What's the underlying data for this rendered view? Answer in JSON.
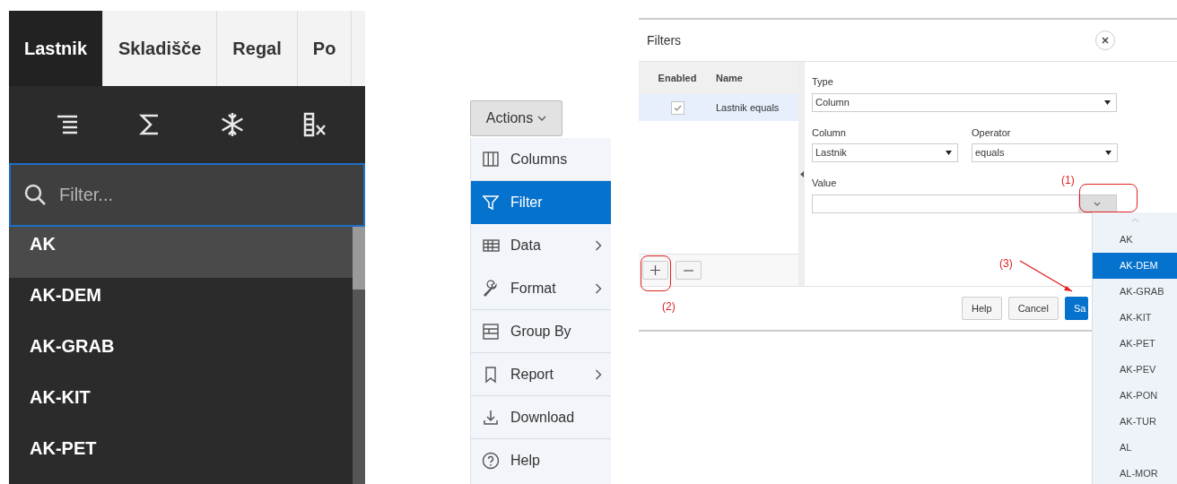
{
  "column_menu": {
    "tabs": [
      {
        "label": "Lastnik",
        "selected": true
      },
      {
        "label": "Skladišče",
        "selected": false
      },
      {
        "label": "Regal",
        "selected": false
      },
      {
        "label": "Po",
        "selected": false
      }
    ],
    "filter": {
      "placeholder": "Filter..."
    },
    "values": [
      {
        "label": "AK",
        "selected": true
      },
      {
        "label": "AK-DEM",
        "selected": false
      },
      {
        "label": "AK-GRAB",
        "selected": false
      },
      {
        "label": "AK-KIT",
        "selected": false
      },
      {
        "label": "AK-PET",
        "selected": false
      }
    ]
  },
  "actions_menu": {
    "button": "Actions",
    "items": [
      {
        "kind": "columns",
        "label": "Columns",
        "selected": false,
        "submenu": false,
        "divider_after": true
      },
      {
        "kind": "filter",
        "label": "Filter",
        "selected": true,
        "submenu": false,
        "divider_after": false
      },
      {
        "kind": "data",
        "label": "Data",
        "selected": false,
        "submenu": true,
        "divider_after": false
      },
      {
        "kind": "format",
        "label": "Format",
        "selected": false,
        "submenu": true,
        "divider_after": true
      },
      {
        "kind": "group",
        "label": "Group By",
        "selected": false,
        "submenu": false,
        "divider_after": true
      },
      {
        "kind": "report",
        "label": "Report",
        "selected": false,
        "submenu": true,
        "divider_after": true
      },
      {
        "kind": "download",
        "label": "Download",
        "selected": false,
        "submenu": false,
        "divider_after": true
      },
      {
        "kind": "help",
        "label": "Help",
        "selected": false,
        "submenu": false,
        "divider_after": false
      }
    ]
  },
  "filters_dialog": {
    "title": "Filters",
    "list": {
      "columns": [
        "Enabled",
        "Name"
      ],
      "rows": [
        {
          "enabled": true,
          "name": "Lastnik equals",
          "selected": true
        }
      ]
    },
    "form": {
      "type_label": "Type",
      "type_value": "Column",
      "column_label": "Column",
      "column_value": "Lastnik",
      "operator_label": "Operator",
      "operator_value": "equals",
      "value_label": "Value"
    },
    "buttons": [
      {
        "label": "Help",
        "primary": false
      },
      {
        "label": "Cancel",
        "primary": false
      },
      {
        "label": "Sa",
        "primary": true
      }
    ],
    "value_options": [
      {
        "label": "AK",
        "selected": false
      },
      {
        "label": "AK-DEM",
        "selected": true
      },
      {
        "label": "AK-GRAB",
        "selected": false
      },
      {
        "label": "AK-KIT",
        "selected": false
      },
      {
        "label": "AK-PET",
        "selected": false
      },
      {
        "label": "AK-PEV",
        "selected": false
      },
      {
        "label": "AK-PON",
        "selected": false
      },
      {
        "label": "AK-TUR",
        "selected": false
      },
      {
        "label": "AL",
        "selected": false
      },
      {
        "label": "AL-MOR",
        "selected": false
      }
    ]
  },
  "annotations": [
    "(1)",
    "(2)",
    "(3)"
  ]
}
